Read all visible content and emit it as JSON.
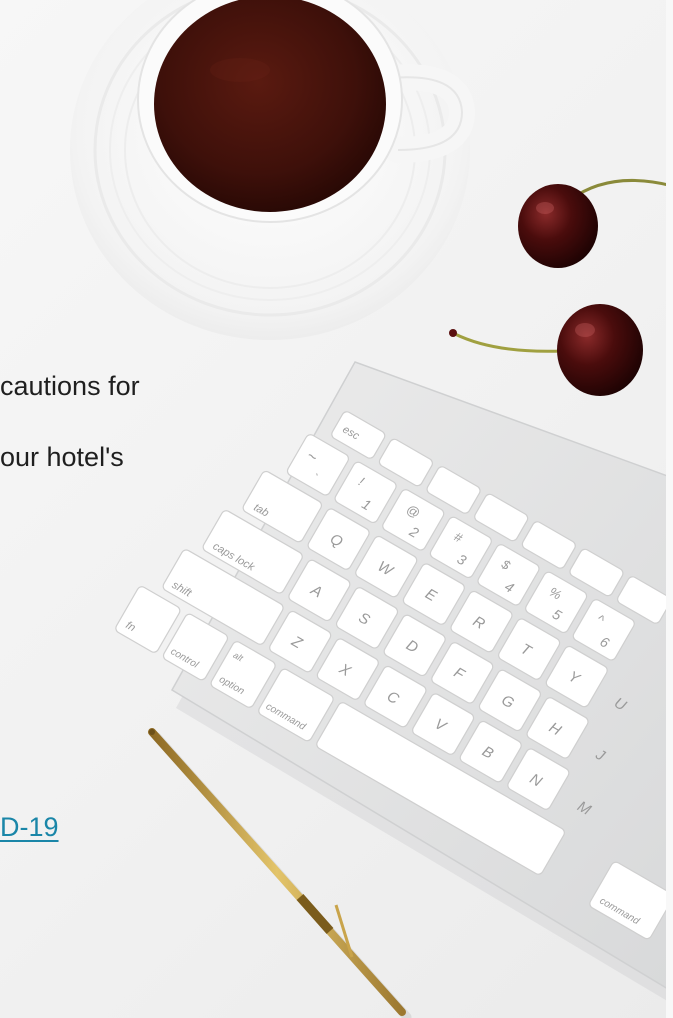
{
  "content": {
    "line_1": "cautions for",
    "line_2": "our hotel's",
    "link_text": "D-19"
  },
  "photo": {
    "objects": [
      "coffee-cup",
      "cherry",
      "cherry",
      "keyboard",
      "pen"
    ],
    "keyboard_keys": {
      "esc": "esc",
      "tab": "tab",
      "caps": "caps lock",
      "shift": "shift",
      "fn": "fn",
      "control": "control",
      "alt": "alt",
      "option": "option",
      "command": "command",
      "command_right": "command",
      "letters": [
        "Q",
        "W",
        "E",
        "R",
        "T",
        "Y",
        "U",
        "A",
        "S",
        "D",
        "F",
        "G",
        "H",
        "J",
        "Z",
        "X",
        "C",
        "V",
        "B",
        "N",
        "M"
      ],
      "numbers": [
        "!",
        "1",
        "@",
        "2",
        "#",
        "3",
        "$",
        "4",
        "%",
        "5",
        "^",
        "6"
      ],
      "tilde": "~",
      "backtick": "`"
    }
  },
  "colors": {
    "background": "#f4f4f4",
    "text": "#1f1f1f",
    "link": "#1a86a8",
    "coffee": "#3e100a",
    "cup": "#fafafa",
    "keyboard": "#e4e5e6",
    "pen_gold": "#c9a44b",
    "cherry": "#3b0a0a"
  }
}
